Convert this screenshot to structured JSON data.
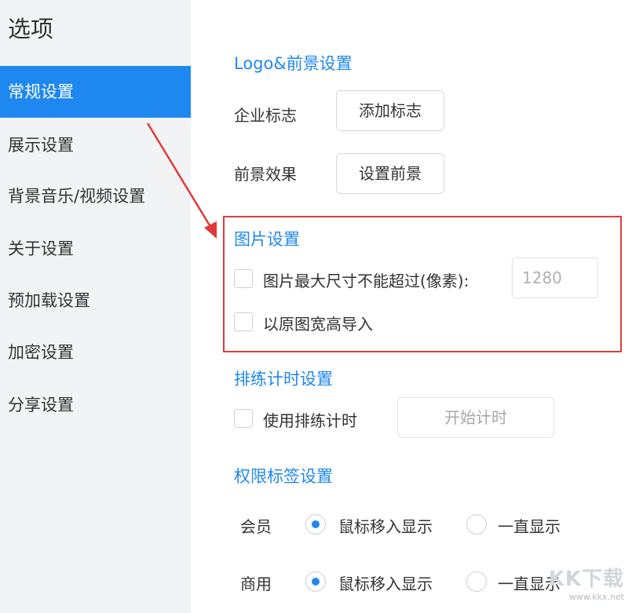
{
  "sidebar": {
    "title": "选项",
    "items": [
      {
        "label": "常规设置"
      },
      {
        "label": "展示设置"
      },
      {
        "label": "背景音乐/视频设置"
      },
      {
        "label": "关于设置"
      },
      {
        "label": "预加载设置"
      },
      {
        "label": "加密设置"
      },
      {
        "label": "分享设置"
      }
    ]
  },
  "main": {
    "logo_section": {
      "title": "Logo&前景设置",
      "company_logo_label": "企业标志",
      "add_logo_button": "添加标志",
      "foreground_label": "前景效果",
      "set_foreground_button": "设置前景"
    },
    "image_section": {
      "title": "图片设置",
      "max_size_label": "图片最大尺寸不能超过(像素):",
      "max_size_value": "1280",
      "original_size_label": "以原图宽高导入"
    },
    "rehearsal_section": {
      "title": "排练计时设置",
      "use_timer_label": "使用排练计时",
      "start_timer_button": "开始计时"
    },
    "permission_section": {
      "title": "权限标签设置",
      "rows": [
        {
          "label": "会员",
          "option1": "鼠标移入显示",
          "option2": "一直显示"
        },
        {
          "label": "商用",
          "option1": "鼠标移入显示",
          "option2": "一直显示"
        }
      ]
    }
  },
  "watermark": {
    "logo": "KK下载",
    "url": "www.kkx.net"
  },
  "colors": {
    "accent": "#1e88f0",
    "highlight": "#e03a3a",
    "sidebar_bg": "#f2f3f5"
  }
}
